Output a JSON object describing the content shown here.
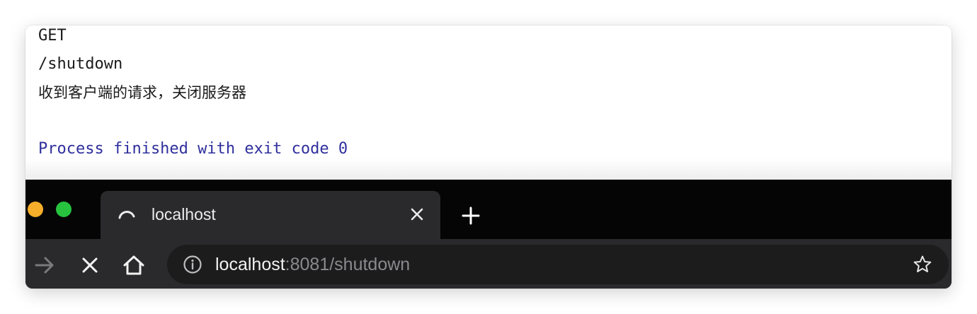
{
  "console": {
    "lines": {
      "method": "GET",
      "path": "/shutdown",
      "message": "收到客户端的请求，关闭服务器",
      "exit": "Process finished with exit code 0"
    },
    "colors": {
      "exit_text": "#2f2f9e"
    }
  },
  "browser": {
    "tab": {
      "title": "localhost",
      "icon": "loading-spinner-icon",
      "close_icon": "close-icon"
    },
    "new_tab_icon": "plus-icon",
    "toolbar": {
      "forward_icon": "arrow-right-icon",
      "stop_icon": "close-icon",
      "home_icon": "home-icon"
    },
    "address": {
      "host": "localhost",
      "rest": ":8081/shutdown",
      "info_icon": "info-icon",
      "bookmark_icon": "star-icon"
    },
    "window_controls": {
      "minimize_color": "#f6ae2b",
      "maximize_color": "#27c33f"
    }
  }
}
